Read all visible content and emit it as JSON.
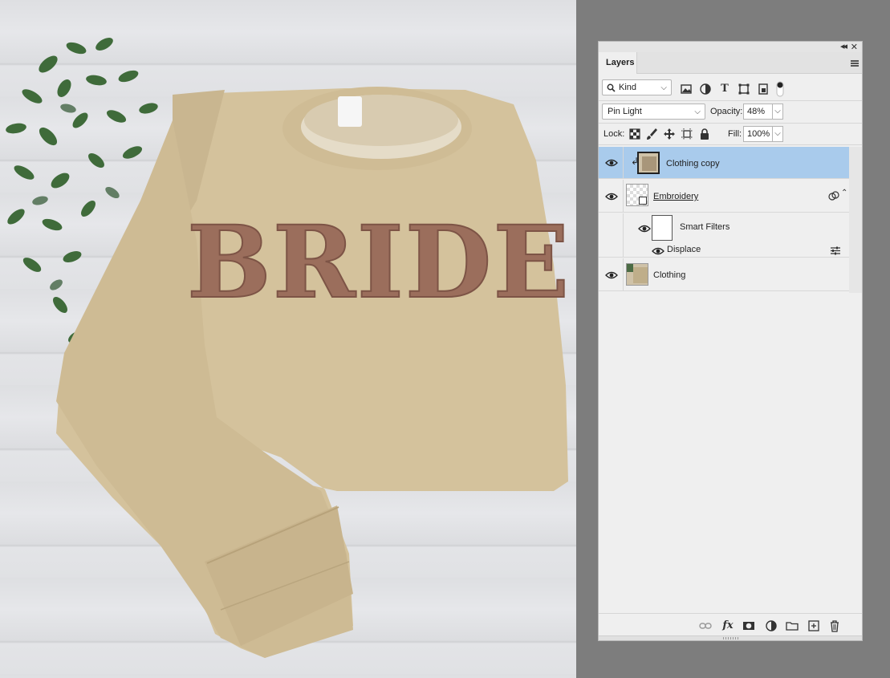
{
  "canvas": {
    "image_text": "BRIDE"
  },
  "panel": {
    "tab_label": "Layers",
    "filter": {
      "kind_label": "Kind",
      "icons": [
        "image-filter-icon",
        "adjustment-filter-icon",
        "type-filter-icon",
        "shape-filter-icon",
        "smart-object-filter-icon",
        "filter-toggle-icon"
      ]
    },
    "blend": {
      "mode": "Pin Light",
      "opacity_label": "Opacity:",
      "opacity_value": "48%"
    },
    "lock": {
      "label": "Lock:",
      "fill_label": "Fill:",
      "fill_value": "100%"
    },
    "layers": [
      {
        "name": "Clothing copy",
        "selected": true,
        "clipped": true
      },
      {
        "name": "Embroidery",
        "smart_object": true
      },
      {
        "name": "Smart Filters"
      },
      {
        "name": "Displace"
      },
      {
        "name": "Clothing"
      }
    ],
    "footer_icons": [
      "link-icon",
      "fx-icon",
      "mask-icon",
      "adjustment-icon",
      "group-icon",
      "new-layer-icon",
      "trash-icon"
    ],
    "fx_label": "fx",
    "colors": {
      "selection": "#a9cbec",
      "panel_bg": "#efefef"
    }
  }
}
